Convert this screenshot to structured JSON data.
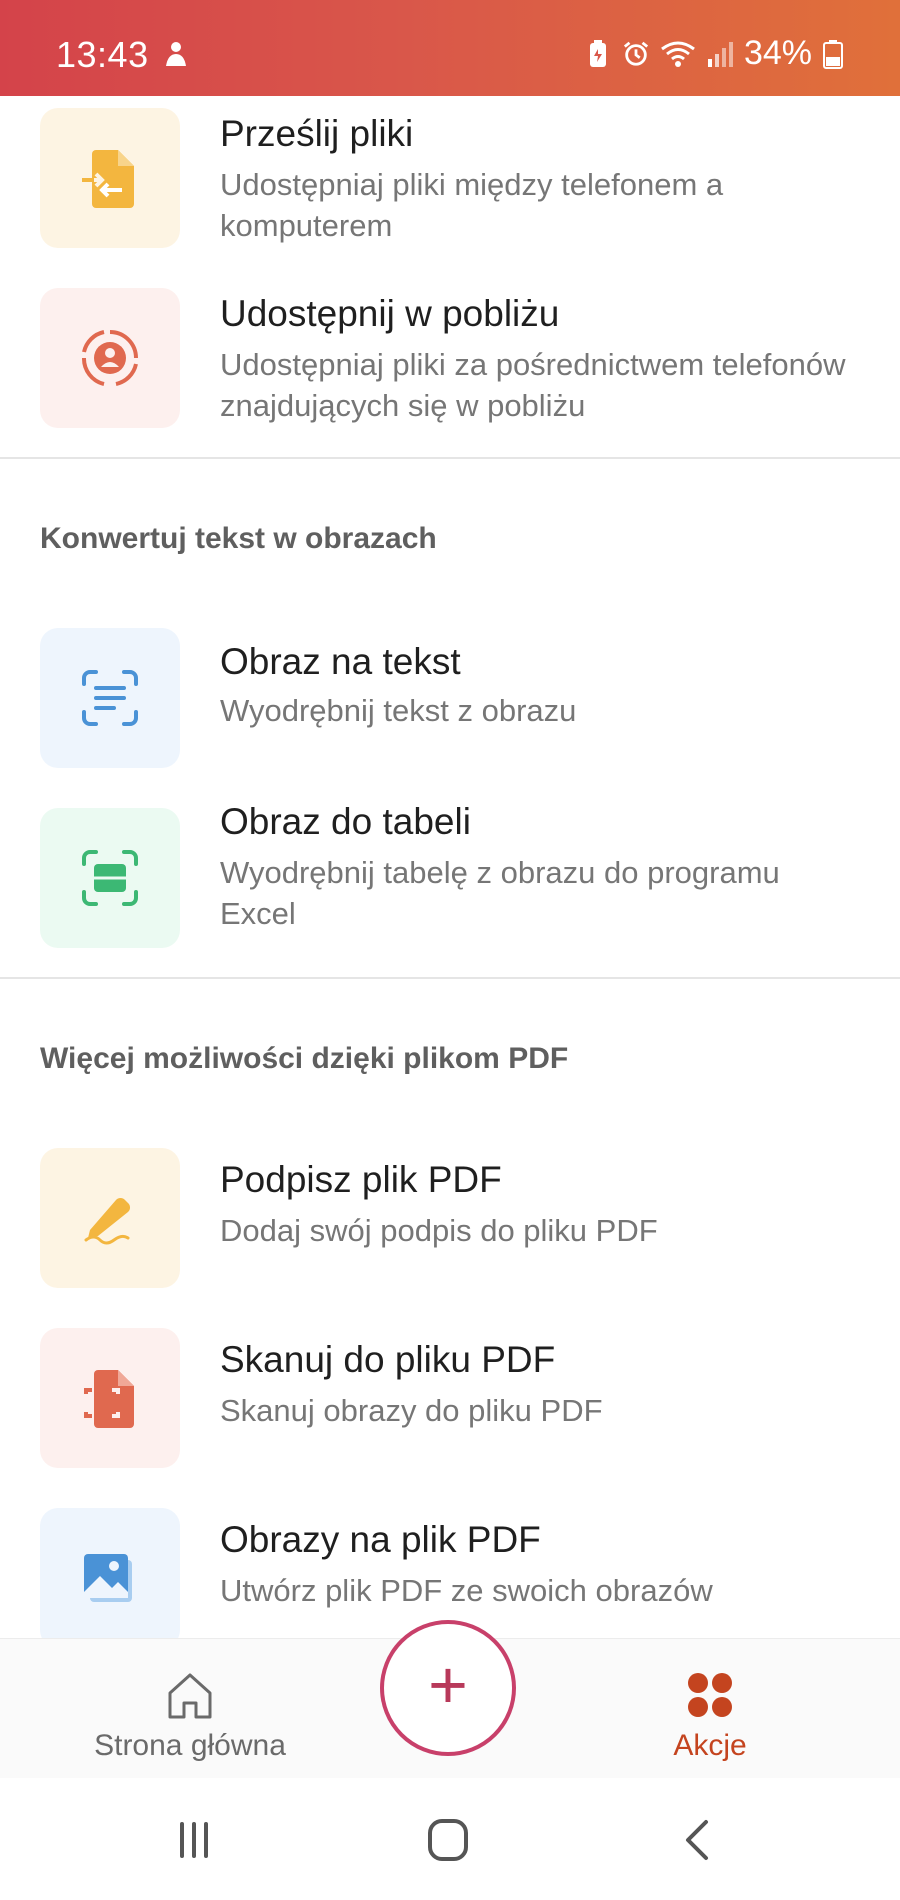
{
  "status_bar": {
    "time": "13:43",
    "battery": "34%",
    "icons": [
      "notification-person-icon",
      "battery-saver-icon",
      "alarm-icon",
      "wifi-icon",
      "signal-icon",
      "battery-icon"
    ]
  },
  "sections": {
    "share_items": [
      {
        "title": "Prześlij pliki",
        "desc": "Udostępniaj pliki między telefonem a komputerem",
        "icon": "file-transfer-icon",
        "tile_color": "#fdf4e3",
        "icon_color": "#f3b63f"
      },
      {
        "title": "Udostępnij w pobliżu",
        "desc": "Udostępniaj pliki za pośrednictwem telefonów znajdujących się w pobliżu",
        "icon": "nearby-share-icon",
        "tile_color": "#fdf0ee",
        "icon_color": "#e0694f"
      }
    ],
    "convert": {
      "heading": "Konwertuj tekst w obrazach",
      "items": [
        {
          "title": "Obraz na tekst",
          "desc": "Wyodrębnij tekst z obrazu",
          "icon": "image-to-text-icon",
          "tile_color": "#eef5fd",
          "icon_color": "#4a92d6"
        },
        {
          "title": "Obraz do tabeli",
          "desc": "Wyodrębnij tabelę z obrazu do programu Excel",
          "icon": "image-to-table-icon",
          "tile_color": "#ebfaf2",
          "icon_color": "#3cb874"
        }
      ]
    },
    "pdf": {
      "heading": "Więcej możliwości dzięki plikom PDF",
      "items": [
        {
          "title": "Podpisz plik PDF",
          "desc": "Dodaj swój podpis do pliku PDF",
          "icon": "sign-pen-icon",
          "tile_color": "#fdf4e3",
          "icon_color": "#f3b63f"
        },
        {
          "title": "Skanuj do pliku PDF",
          "desc": "Skanuj obrazy do pliku PDF",
          "icon": "scan-to-pdf-icon",
          "tile_color": "#fdf0ee",
          "icon_color": "#e0694f"
        },
        {
          "title": "Obrazy na plik PDF",
          "desc": "Utwórz plik PDF ze swoich obrazów",
          "icon": "images-to-pdf-icon",
          "tile_color": "#eef5fd",
          "icon_color": "#4a92d6"
        }
      ]
    }
  },
  "bottom_nav": {
    "home_label": "Strona główna",
    "actions_label": "Akcje",
    "fab_label": "+",
    "active": "Akcje",
    "accent_color": "#c4441f"
  },
  "system_nav": {
    "icons": [
      "recent-apps-icon",
      "home-circle-icon",
      "back-icon"
    ]
  }
}
